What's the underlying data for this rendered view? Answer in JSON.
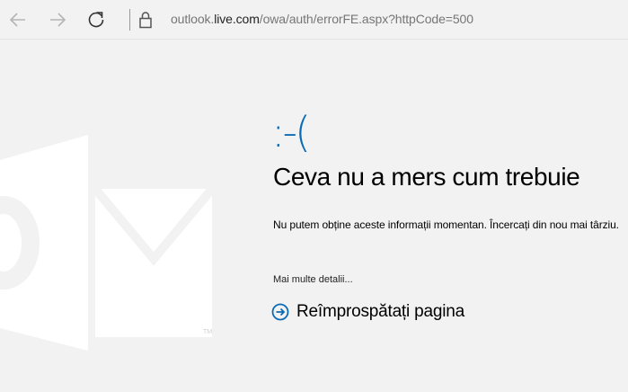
{
  "browser": {
    "address": {
      "prefix": "outlook.",
      "host": "live.com",
      "path": "/owa/auth/errorFE.aspx?httpCode=500"
    }
  },
  "error": {
    "face": ":-(",
    "title": "Ceva nu a mers cum trebuie",
    "message": "Nu putem obține aceste informații momentan. Încercați din nou mai târziu.",
    "more_details": "Mai multe detalii...",
    "refresh_label": "Reîmprospătați pagina"
  },
  "colors": {
    "accent": "#0a6ab5",
    "logo": "#ffffff"
  },
  "icons": [
    "back-arrow-icon",
    "forward-arrow-icon",
    "refresh-icon",
    "lock-icon",
    "outlook-logo-icon",
    "circle-arrow-icon"
  ]
}
